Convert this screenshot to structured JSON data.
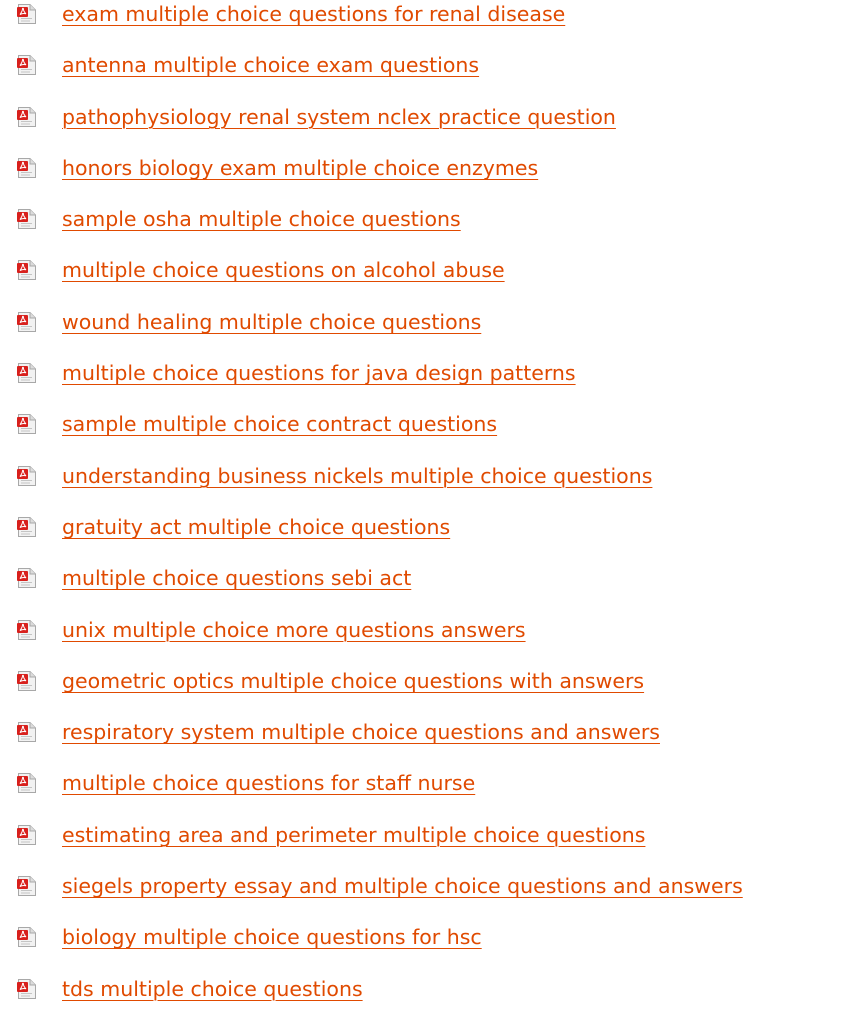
{
  "links": [
    {
      "label": "exam multiple choice questions for renal disease",
      "icon": "pdf-file-icon"
    },
    {
      "label": "antenna multiple choice exam questions",
      "icon": "pdf-file-icon"
    },
    {
      "label": "pathophysiology renal system nclex practice question",
      "icon": "pdf-file-icon"
    },
    {
      "label": "honors biology exam multiple choice enzymes",
      "icon": "pdf-file-icon"
    },
    {
      "label": "sample osha multiple choice questions",
      "icon": "pdf-file-icon"
    },
    {
      "label": "multiple choice questions on alcohol abuse",
      "icon": "pdf-file-icon"
    },
    {
      "label": "wound healing multiple choice questions",
      "icon": "pdf-file-icon"
    },
    {
      "label": "multiple choice questions for java design patterns",
      "icon": "pdf-file-icon"
    },
    {
      "label": "sample multiple choice contract questions",
      "icon": "pdf-file-icon"
    },
    {
      "label": "understanding business nickels multiple choice questions",
      "icon": "pdf-file-icon"
    },
    {
      "label": "gratuity act multiple choice questions",
      "icon": "pdf-file-icon"
    },
    {
      "label": "multiple choice questions sebi act",
      "icon": "pdf-file-icon"
    },
    {
      "label": "unix multiple choice more questions answers",
      "icon": "pdf-file-icon"
    },
    {
      "label": "geometric optics multiple choice questions with answers",
      "icon": "pdf-file-icon"
    },
    {
      "label": "respiratory system multiple choice questions and answers",
      "icon": "pdf-file-icon"
    },
    {
      "label": "multiple choice questions for staff nurse",
      "icon": "pdf-file-icon"
    },
    {
      "label": "estimating area and perimeter multiple choice questions",
      "icon": "pdf-file-icon"
    },
    {
      "label": "siegels property essay and multiple choice questions and answers",
      "icon": "pdf-file-icon"
    },
    {
      "label": "biology multiple choice questions for hsc",
      "icon": "pdf-file-icon"
    },
    {
      "label": "tds multiple choice questions",
      "icon": "pdf-file-icon"
    }
  ],
  "colors": {
    "link": "#e04a00",
    "icon_red": "#d8201c",
    "icon_paper": "#f4f4f4"
  }
}
